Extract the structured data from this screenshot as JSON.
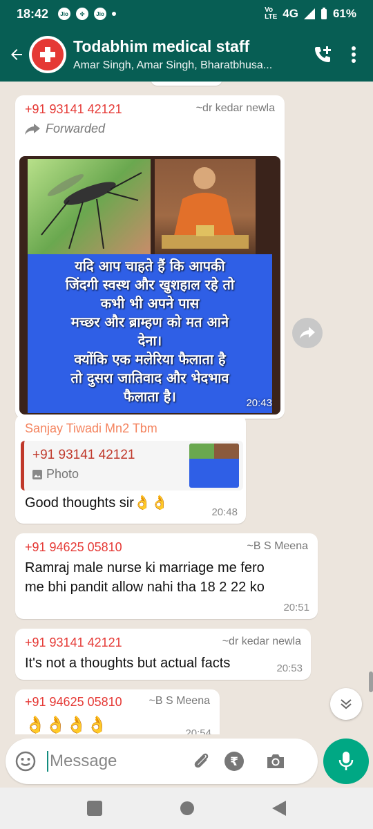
{
  "status_bar": {
    "time": "18:42",
    "carrier_icon": "Jio",
    "network": "4G",
    "battery": "61%"
  },
  "header": {
    "group_name": "Todabhim medical staff",
    "members": "Amar Singh, Amar Singh, Bharatbhusa..."
  },
  "messages": [
    {
      "sender": "+91 93141 42121",
      "alias": "~dr kedar newla",
      "forwarded_label": "Forwarded",
      "image_text": [
        "यदि आप चाहते हैं कि आपकी",
        "जिंदगी स्वस्थ और खुशहाल रहे तो",
        "कभी भी अपने पास",
        "मच्छर और ब्राम्हण को मत आने",
        "देना।",
        "क्योंकि एक  मलेरिया फैलाता है",
        "तो दुसरा जातिवाद और भेदभाव",
        "फैलाता है।"
      ],
      "time": "20:43"
    },
    {
      "sender": "Sanjay Tiwadi Mn2 Tbm",
      "quoted_sender": "+91 93141 42121",
      "quoted_type": "Photo",
      "text": "Good thoughts sir👌👌",
      "time": "20:48"
    },
    {
      "sender": "+91 94625 05810",
      "alias": "~B S Meena",
      "text_lines": [
        "Ramraj male nurse ki marriage  me fero",
        "me bhi pandit allow nahi tha 18 2 22 ko"
      ],
      "time": "20:51"
    },
    {
      "sender": "+91 93141 42121",
      "alias": "~dr kedar newla",
      "text": "It's not a thoughts but actual facts",
      "time": "20:53"
    },
    {
      "sender": "+91 94625 05810",
      "alias": "~B S Meena",
      "text": "👌👌👌👌",
      "time": "20:54"
    }
  ],
  "input": {
    "placeholder": "Message"
  },
  "colors": {
    "header": "#075e54",
    "accent": "#00a884",
    "sender_red": "#e53935",
    "sender_orange": "#f4845f"
  },
  "icons": [
    "back-arrow-icon",
    "add-call-icon",
    "more-vert-icon",
    "forward-icon",
    "photo-icon",
    "emoji-icon",
    "attach-icon",
    "rupee-icon",
    "camera-icon",
    "mic-icon",
    "scroll-down-icon"
  ]
}
